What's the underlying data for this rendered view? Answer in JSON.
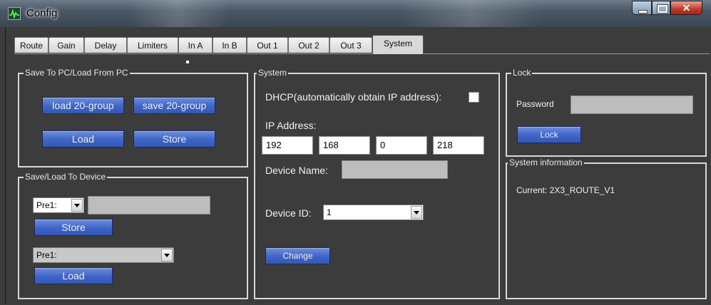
{
  "window": {
    "title": "Config"
  },
  "tabs": [
    {
      "label": "Route"
    },
    {
      "label": "Gain"
    },
    {
      "label": "Delay"
    },
    {
      "label": "Limiters"
    },
    {
      "label": "In A"
    },
    {
      "label": "In B"
    },
    {
      "label": "Out 1"
    },
    {
      "label": "Out 2"
    },
    {
      "label": "Out 3"
    },
    {
      "label": "System"
    }
  ],
  "active_tab": "System",
  "pc_group": {
    "title": "Save To PC/Load From PC",
    "load_group_label": "load 20-group",
    "save_group_label": "save 20-group",
    "load_label": "Load",
    "store_label": "Store"
  },
  "device_group": {
    "title": "Save/Load To Device",
    "preset_select_value": "Pre1:",
    "store_label": "Store",
    "preset_combo_value": "Pre1:",
    "load_label": "Load"
  },
  "system_group": {
    "title": "System",
    "dhcp_label": "DHCP(automatically obtain IP address):",
    "dhcp_checked": false,
    "ip_label": "IP Address:",
    "ip": [
      "192",
      "168",
      "0",
      "218"
    ],
    "device_name_label": "Device Name:",
    "device_name_value": "",
    "device_id_label": "Device ID:",
    "device_id_value": "1",
    "change_label": "Change"
  },
  "lock_group": {
    "title": "Lock",
    "password_label": "Password",
    "password_value": "",
    "lock_label": "Lock"
  },
  "info_group": {
    "title": "System information",
    "current_text": "Current: 2X3_ROUTE_V1"
  }
}
